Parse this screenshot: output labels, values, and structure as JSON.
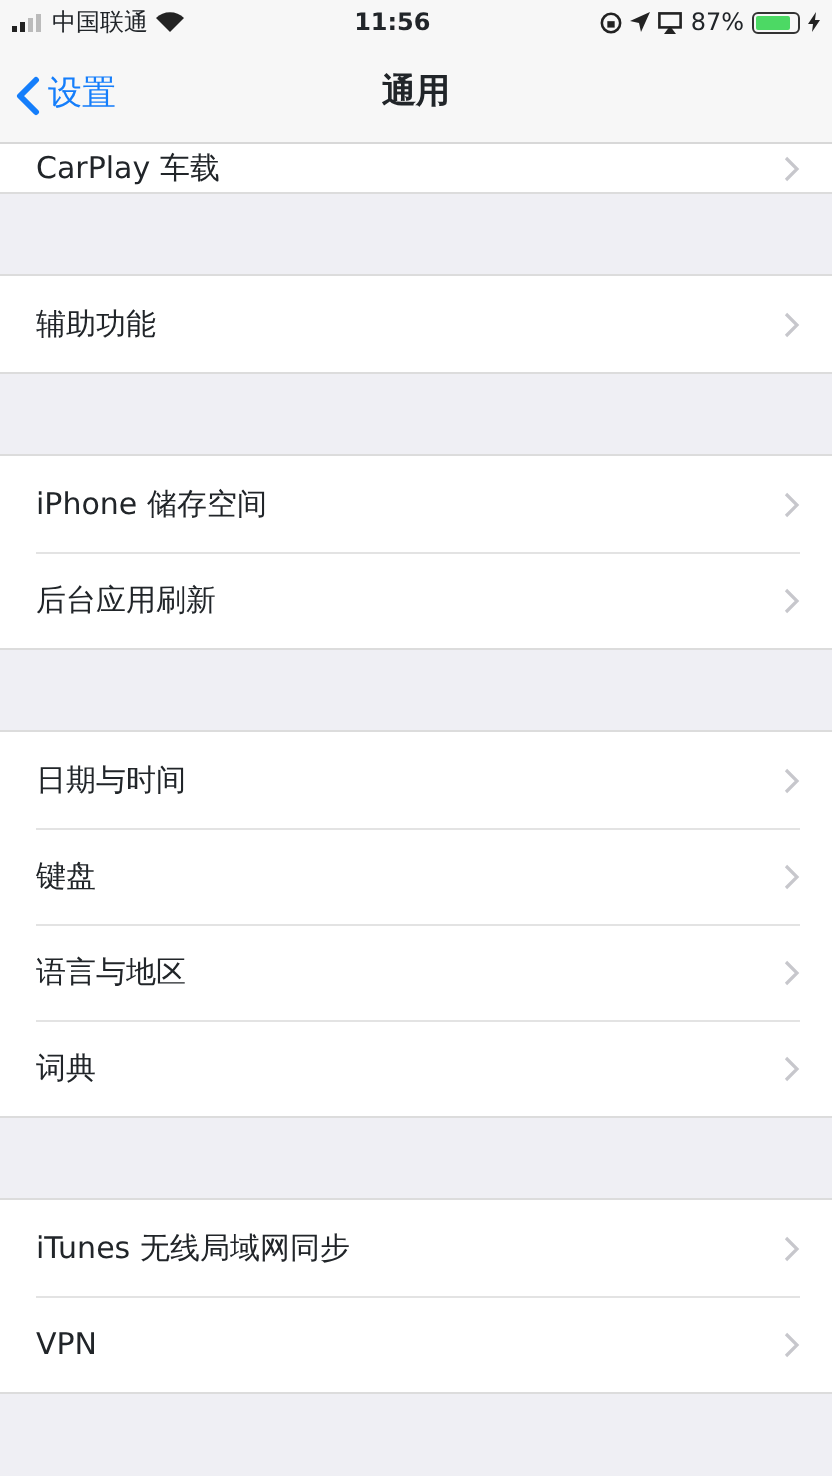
{
  "status_bar": {
    "carrier": "中国联通",
    "time": "11:56",
    "battery_text": "87%",
    "battery": {
      "level": 0.87
    }
  },
  "nav_bar": {
    "back": "设置",
    "title": "通用"
  },
  "groups": [
    {
      "kind": "short",
      "items": [
        {
          "label": "CarPlay 车载"
        }
      ]
    },
    {
      "items": [
        {
          "label": "辅助功能"
        }
      ]
    },
    {
      "items": [
        {
          "label": "iPhone 储存空间"
        },
        {
          "label": "后台应用刷新"
        }
      ]
    },
    {
      "items": [
        {
          "label": "日期与时间"
        },
        {
          "label": "键盘"
        },
        {
          "label": "语言与地区"
        },
        {
          "label": "词典"
        }
      ]
    },
    {
      "items": [
        {
          "label": "iTunes 无线局域网同步"
        },
        {
          "label": "VPN"
        }
      ]
    }
  ]
}
